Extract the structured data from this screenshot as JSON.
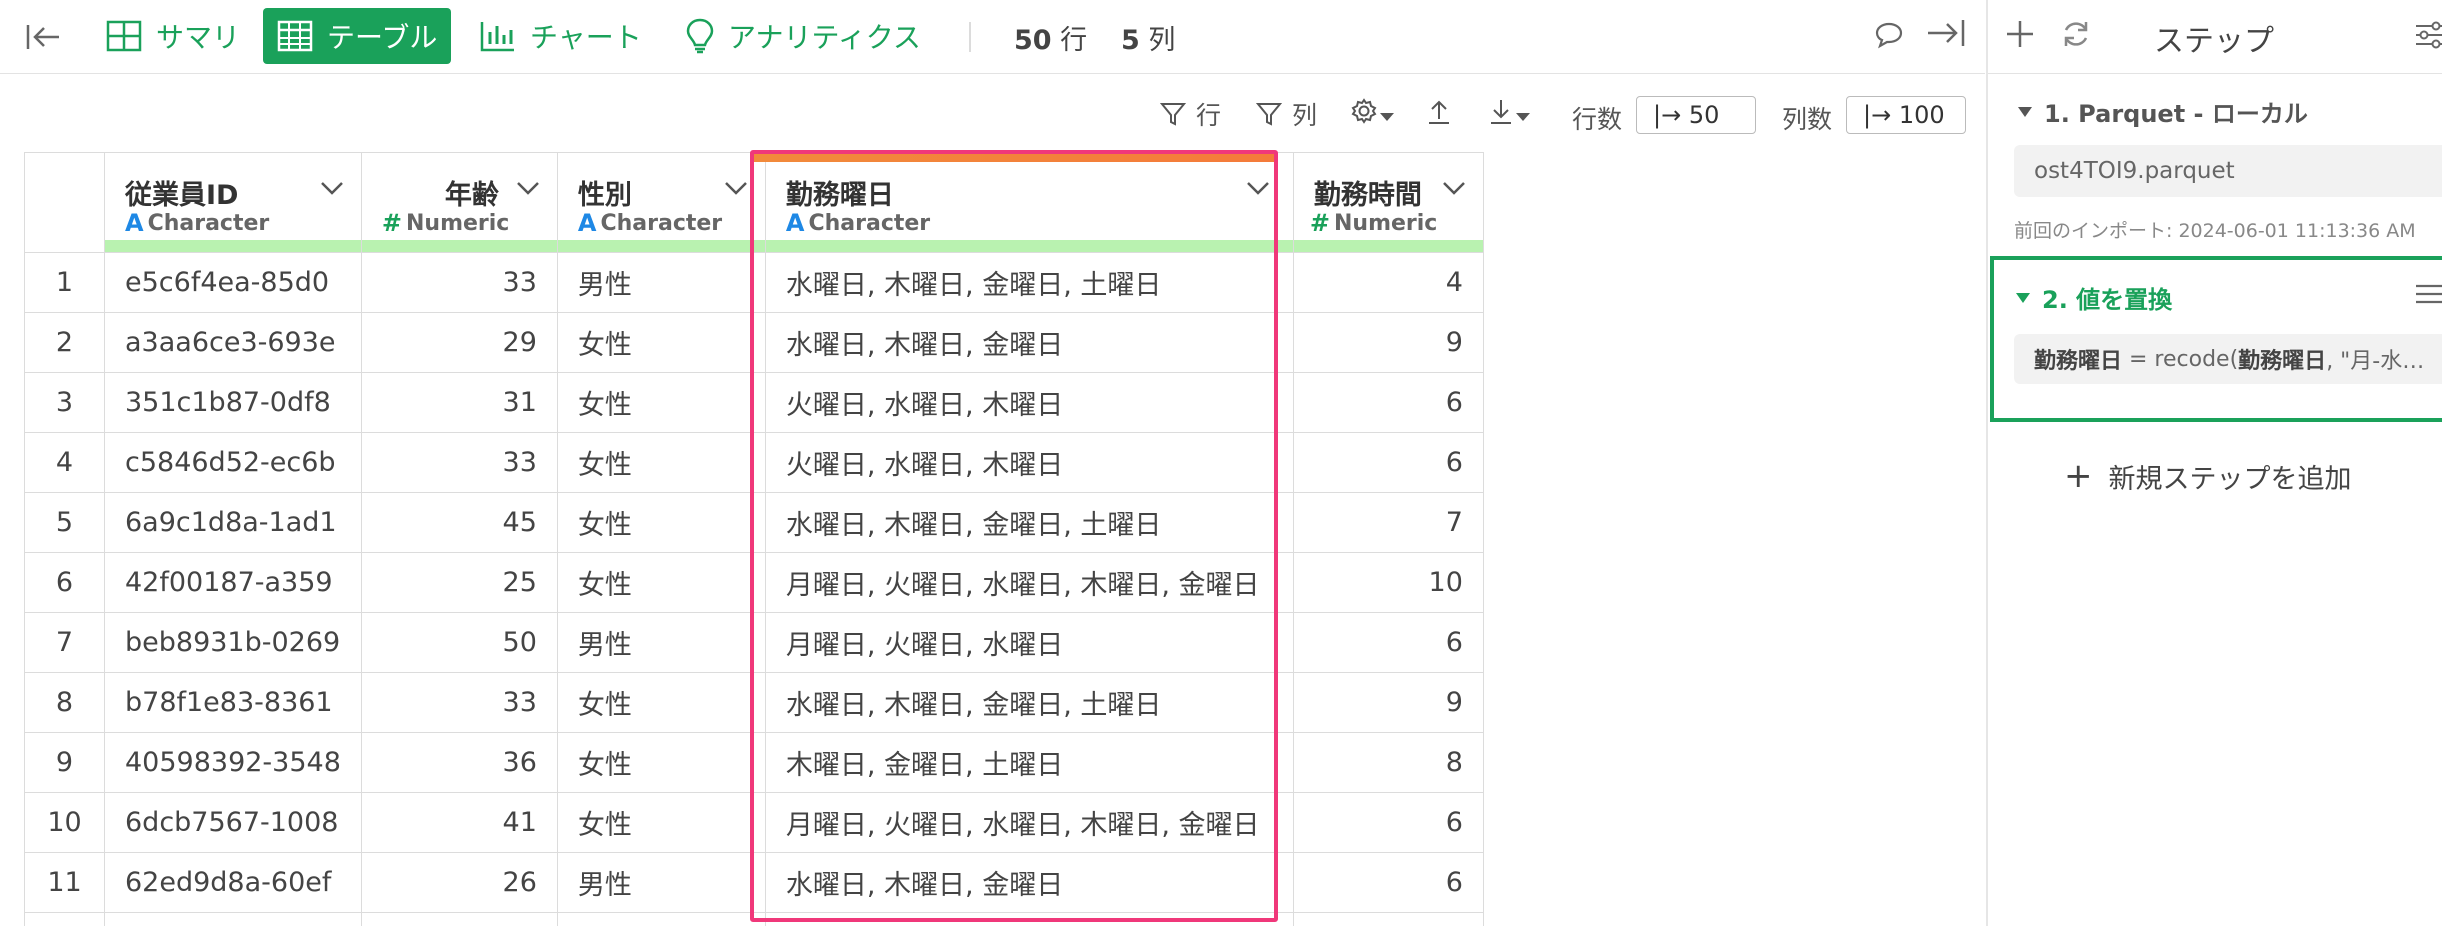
{
  "toolbar": {
    "tabs": [
      {
        "label": "サマリ",
        "icon": "summary-icon"
      },
      {
        "label": "テーブル",
        "icon": "table-icon",
        "active": true
      },
      {
        "label": "チャート",
        "icon": "chart-icon"
      },
      {
        "label": "アナリティクス",
        "icon": "lightbulb-icon"
      }
    ],
    "rows_count": "50",
    "rows_unit": "行",
    "cols_count": "5",
    "cols_unit": "列"
  },
  "subtoolbar": {
    "row_filter": "行",
    "col_filter": "列",
    "rows_label": "行数",
    "rows_value": "|→ 50",
    "cols_label": "列数",
    "cols_value": "|→ 100"
  },
  "table": {
    "columns": [
      {
        "name": "従業員ID",
        "type": "Character",
        "type_glyph": "A"
      },
      {
        "name": "年齢",
        "type": "Numeric",
        "type_glyph": "#"
      },
      {
        "name": "性別",
        "type": "Character",
        "type_glyph": "A"
      },
      {
        "name": "勤務曜日",
        "type": "Character",
        "type_glyph": "A"
      },
      {
        "name": "勤務時間",
        "type": "Numeric",
        "type_glyph": "#"
      }
    ],
    "rows": [
      [
        "1",
        "e5c6f4ea-85d0",
        "33",
        "男性",
        "水曜日, 木曜日, 金曜日, 土曜日",
        "4"
      ],
      [
        "2",
        "a3aa6ce3-693e",
        "29",
        "女性",
        "水曜日, 木曜日, 金曜日",
        "9"
      ],
      [
        "3",
        "351c1b87-0df8",
        "31",
        "女性",
        "火曜日, 水曜日, 木曜日",
        "6"
      ],
      [
        "4",
        "c5846d52-ec6b",
        "33",
        "女性",
        "火曜日, 水曜日, 木曜日",
        "6"
      ],
      [
        "5",
        "6a9c1d8a-1ad1",
        "45",
        "女性",
        "水曜日, 木曜日, 金曜日, 土曜日",
        "7"
      ],
      [
        "6",
        "42f00187-a359",
        "25",
        "女性",
        "月曜日, 火曜日, 水曜日, 木曜日, 金曜日",
        "10"
      ],
      [
        "7",
        "beb8931b-0269",
        "50",
        "男性",
        "月曜日, 火曜日, 水曜日",
        "6"
      ],
      [
        "8",
        "b78f1e83-8361",
        "33",
        "女性",
        "水曜日, 木曜日, 金曜日, 土曜日",
        "9"
      ],
      [
        "9",
        "40598392-3548",
        "36",
        "女性",
        "木曜日, 金曜日, 土曜日",
        "8"
      ],
      [
        "10",
        "6dcb7567-1008",
        "41",
        "女性",
        "月曜日, 火曜日, 水曜日, 木曜日, 金曜日",
        "6"
      ],
      [
        "11",
        "62ed9d8a-60ef",
        "26",
        "男性",
        "水曜日, 木曜日, 金曜日",
        "6"
      ]
    ],
    "selected_column": "勤務曜日"
  },
  "steps_panel": {
    "title": "ステップ",
    "step1": {
      "title": "1. Parquet - ローカル",
      "file": "ost4TOI9.parquet",
      "meta": "前回のインポート: 2024-06-01 11:13:36 AM"
    },
    "step2": {
      "title": "2. 値を置換",
      "expr_col": "勤務曜日",
      "expr_eq": " = recode(",
      "expr_arg": "勤務曜日",
      "expr_rest": ", \"月-水…"
    },
    "add_step": "新規ステップを追加"
  },
  "colors": {
    "accent": "#1aa15a",
    "selection": "#f0387a",
    "character_type": "#1e88e5",
    "header_quality_bar": "#b9f2b0"
  }
}
